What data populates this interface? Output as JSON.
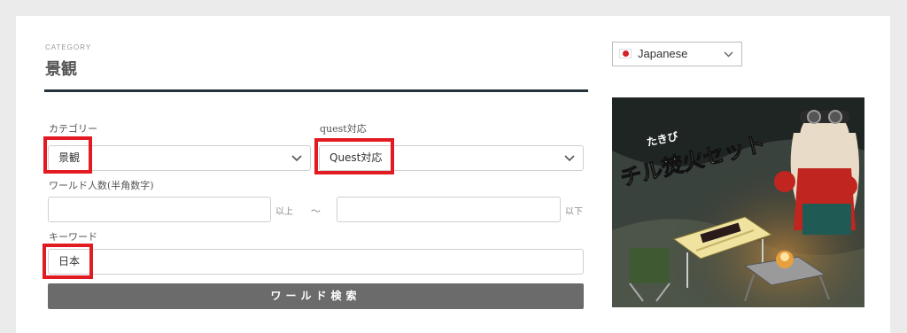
{
  "header": {
    "category_label": "CATEGORY",
    "title": "景観"
  },
  "form": {
    "category": {
      "label": "カテゴリー",
      "selected": "景観"
    },
    "quest": {
      "label": "quest対応",
      "selected": "Quest対応"
    },
    "world_count": {
      "label": "ワールド人数(半角数字)",
      "min_value": "",
      "min_unit": "以上",
      "separator": "〜",
      "max_value": "",
      "max_unit": "以下"
    },
    "keyword": {
      "label": "キーワード",
      "value": "日本"
    },
    "search_button": "ワールド検索"
  },
  "sidebar": {
    "language": {
      "selected": "Japanese",
      "flag_icon": "japan-flag-icon"
    },
    "banner": {
      "title_small": "たきび",
      "title_main": "チル焚火セット"
    }
  },
  "colors": {
    "highlight": "#e21b23",
    "title_rule": "#26333a",
    "button": "#6b6b6b"
  }
}
